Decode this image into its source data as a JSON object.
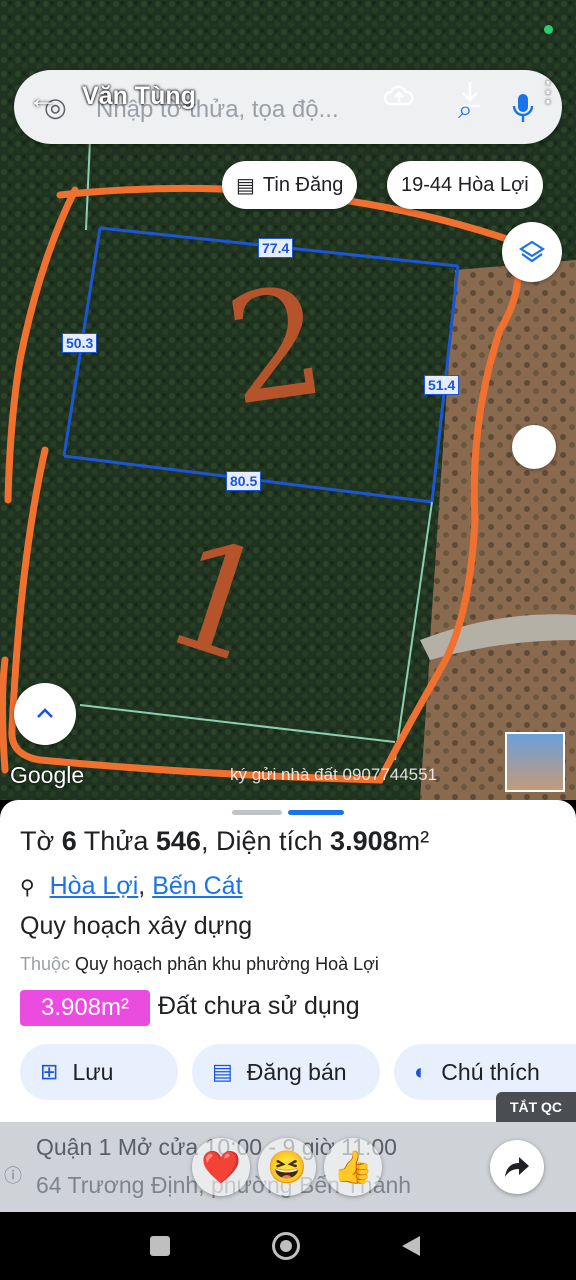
{
  "header": {
    "title": "Văn Tùng",
    "search_placeholder": "Nhập tờ thửa, tọa độ...",
    "icons": [
      "back-arrow-icon",
      "avatar-icon",
      "cloud-upload-icon",
      "download-icon",
      "microphone-icon",
      "more-vert-icon"
    ]
  },
  "map": {
    "chip_tin_dang": "Tin Đăng",
    "chip_location": "19-44 Hòa Lợi",
    "google_label": "Google",
    "watermark": "ký gửi nhà đất 0907744551",
    "handwritten_1": "1",
    "handwritten_2": "2",
    "dimensions": {
      "top": "77.4",
      "left": "50.3",
      "right": "51.4",
      "middle": "80.5"
    }
  },
  "parcel": {
    "sheet_label": "Tờ",
    "sheet_no": "6",
    "plot_label": "Thửa",
    "plot_no": "546",
    "area_label": "Diện tích",
    "area_value": "3.908",
    "area_unit": "m²",
    "ward": "Hòa Lợi",
    "district": "Bến Cát",
    "section_title": "Quy hoạch xây dựng",
    "belongs_label": "Thuộc",
    "belongs_value": "Quy hoạch phân khu phường Hoà Lợi",
    "area_badge": "3.908m²",
    "land_use": "Đất chưa sử dụng"
  },
  "actions": {
    "save": "Lưu",
    "sell": "Đăng bán",
    "legend": "Chú thích"
  },
  "ad": {
    "close_label": "TẮT QC",
    "line1": "Quận 1  Mở cửa 10:00 - 9 giờ 11:00",
    "line2": "64 Trương Định, phường Bến Thành"
  },
  "reactions": [
    "❤️",
    "😆",
    "👍"
  ],
  "colors": {
    "accent": "#1a73e8",
    "badge": "#ea4ce0",
    "boundary": "#1a56d6",
    "annotation": "#f07030"
  }
}
